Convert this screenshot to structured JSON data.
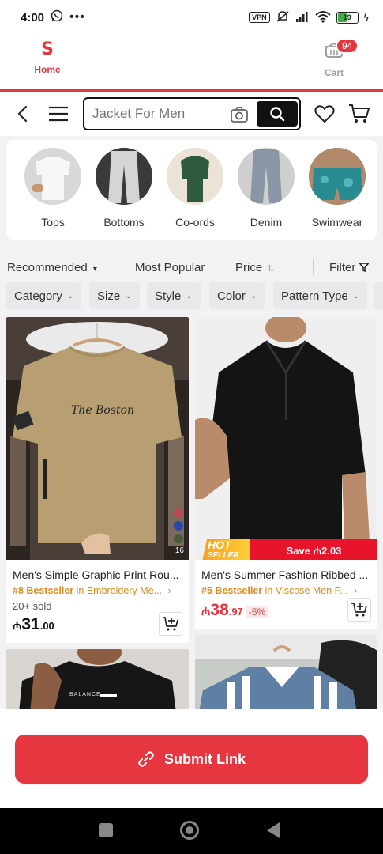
{
  "status_bar": {
    "time": "4:00",
    "vpn": "VPN",
    "battery": "19"
  },
  "app_nav": {
    "home_logo": "S",
    "home_label": "Home",
    "cart_label": "Cart",
    "cart_badge": "94"
  },
  "search": {
    "placeholder": "Jacket For Men"
  },
  "categories": [
    {
      "label": "Tops"
    },
    {
      "label": "Bottoms"
    },
    {
      "label": "Co-ords"
    },
    {
      "label": "Denim"
    },
    {
      "label": "Swimwear"
    }
  ],
  "sort": {
    "recommended": "Recommended",
    "most_popular": "Most Popular",
    "price": "Price",
    "filter": "Filter"
  },
  "filters": [
    {
      "label": "Category"
    },
    {
      "label": "Size"
    },
    {
      "label": "Style"
    },
    {
      "label": "Color"
    },
    {
      "label": "Pattern Type"
    }
  ],
  "products": [
    {
      "title": "Men's Simple Graphic Print Rou...",
      "rank": "#8 Bestseller",
      "category": "in Embroidery Me...",
      "sold": "20+ sold",
      "currency": "₼",
      "price_int": "31",
      "price_dec": ".00",
      "shirt_text": "The Boston",
      "color_count": "16"
    },
    {
      "title": "Men's Summer Fashion Ribbed ...",
      "rank": "#5 Bestseller",
      "category": "in Viscose Men P...",
      "currency": "₼",
      "price_int": "38",
      "price_dec": ".97",
      "discount": "-5%",
      "hot": "HOT",
      "hot_sub": "SELLER",
      "save": "Save ₼2.03"
    },
    {
      "shirt_text": "BALANCE"
    },
    {}
  ],
  "submit": {
    "label": "Submit Link"
  },
  "colors": {
    "accent": "#e4363f",
    "bestseller": "#e08a1e",
    "text": "#222222"
  }
}
